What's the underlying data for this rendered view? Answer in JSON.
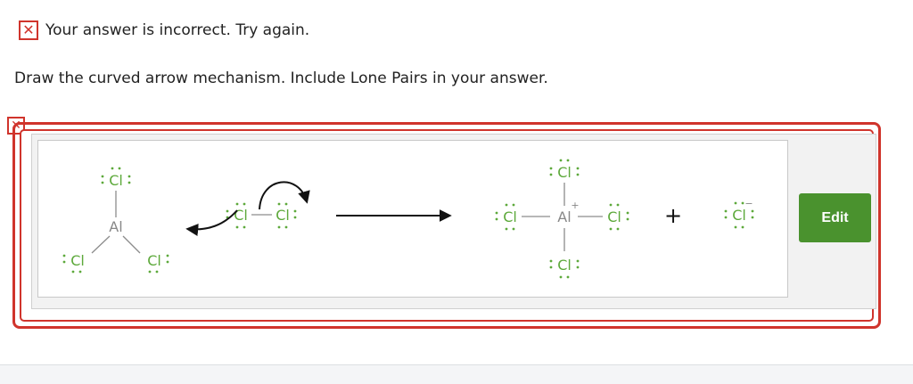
{
  "feedback": {
    "icon": "red-x-icon",
    "text": "Your answer is incorrect.  Try again."
  },
  "instructions": {
    "text": "Draw the curved arrow mechanism. Include Lone Pairs in your answer."
  },
  "editor": {
    "status_icon": "red-x-icon",
    "edit_label": "Edit",
    "reaction": {
      "reactant_1": {
        "center": "Al",
        "ligands": [
          "Cl",
          "Cl",
          "Cl"
        ]
      },
      "reactant_2": {
        "atoms": [
          "Cl",
          "Cl"
        ]
      },
      "reaction_arrow": "reaction-arrow-icon",
      "product_1": {
        "center": "Al",
        "charge": "+",
        "ligands": [
          "Cl",
          "Cl",
          "Cl",
          "Cl"
        ]
      },
      "plus": "+",
      "product_2": {
        "atom": "Cl",
        "charge": "−"
      }
    }
  },
  "colors": {
    "error": "#d0342c",
    "atom": "#5da93b",
    "button": "#4a922e"
  }
}
